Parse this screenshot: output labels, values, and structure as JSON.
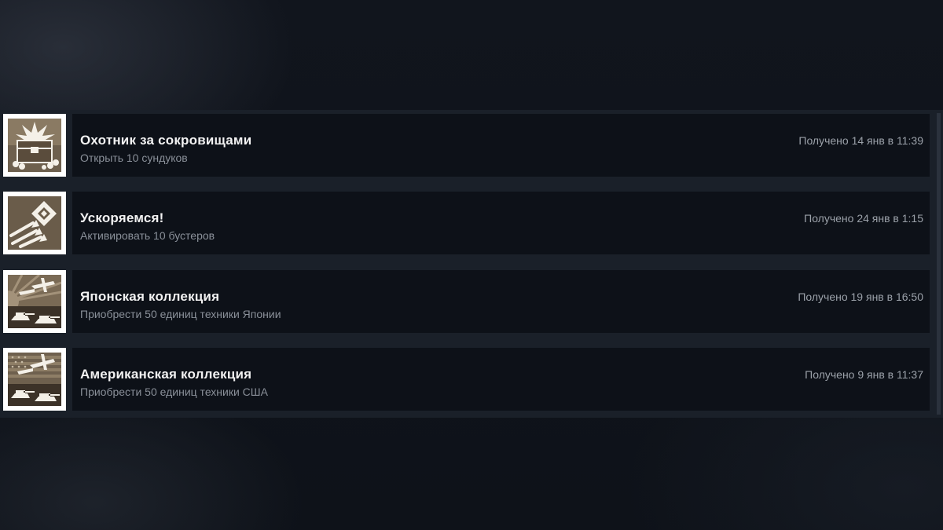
{
  "achievements": [
    {
      "title": "Охотник за сокровищами",
      "description": "Открыть 10 сундуков",
      "unlocked": "Получено 14 янв в 11:39",
      "icon": "treasure-chest-icon"
    },
    {
      "title": "Ускоряемся!",
      "description": "Активировать 10 бустеров",
      "unlocked": "Получено 24 янв в 1:15",
      "icon": "booster-arrows-icon"
    },
    {
      "title": "Японская коллекция",
      "description": "Приобрести 50 единиц техники Японии",
      "unlocked": "Получено 19 янв в 16:50",
      "icon": "japan-collection-icon"
    },
    {
      "title": "Американская коллекция",
      "description": "Приобрести 50 единиц техники США",
      "unlocked": "Получено 9 янв в 11:37",
      "icon": "usa-collection-icon"
    }
  ],
  "colors": {
    "background": "#0f131b",
    "card": "#0d1118",
    "title": "#f2f2f2",
    "description": "#8a9099",
    "date": "#9ba1a9",
    "icon_sepia": "#7a6a55"
  }
}
